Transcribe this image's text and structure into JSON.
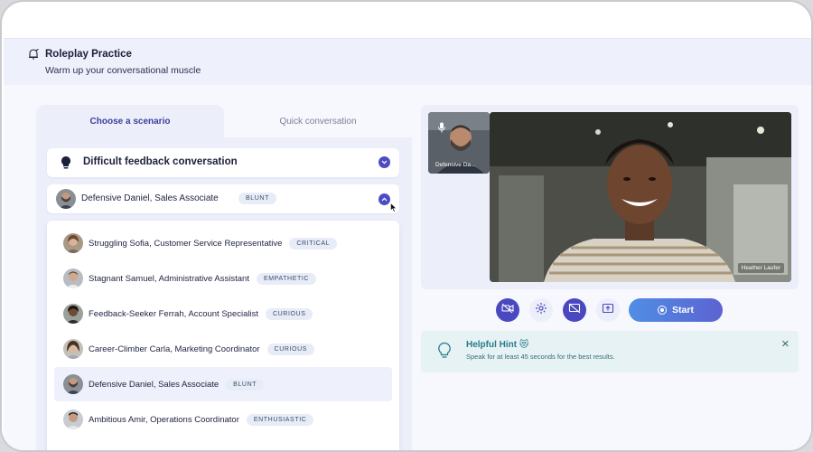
{
  "header": {
    "title": "Roleplay Practice",
    "subtitle": "Warm up your conversational muscle"
  },
  "tabs": [
    {
      "label": "Choose a scenario",
      "active": true
    },
    {
      "label": "Quick conversation",
      "active": false
    }
  ],
  "scenario": {
    "title": "Difficult feedback conversation"
  },
  "selected_persona": {
    "name": "Defensive Daniel, Sales Associate",
    "badge": "BLUNT"
  },
  "personas": [
    {
      "name": "Struggling Sofia, Customer Service Representative",
      "badge": "CRITICAL"
    },
    {
      "name": "Stagnant Samuel, Administrative Assistant",
      "badge": "EMPATHETIC"
    },
    {
      "name": "Feedback-Seeker Ferrah, Account Specialist",
      "badge": "CURIOUS"
    },
    {
      "name": "Career-Climber Carla, Marketing Coordinator",
      "badge": "CURIOUS"
    },
    {
      "name": "Defensive Daniel, Sales Associate",
      "badge": "BLUNT",
      "highlighted": true
    },
    {
      "name": "Ambitious Amir, Operations Coordinator",
      "badge": "ENTHUSIASTIC"
    }
  ],
  "video": {
    "thumb_label": "Defensive Da...",
    "main_label": "Heather Laufer"
  },
  "controls": {
    "start_label": "Start"
  },
  "hint": {
    "title": "Helpful Hint 😻",
    "text": "Speak for at least 45 seconds for the best results."
  },
  "colors": {
    "accent": "#4d4bc2",
    "header_bg": "#eef0fb",
    "hint_bg": "#e6f2f4"
  }
}
